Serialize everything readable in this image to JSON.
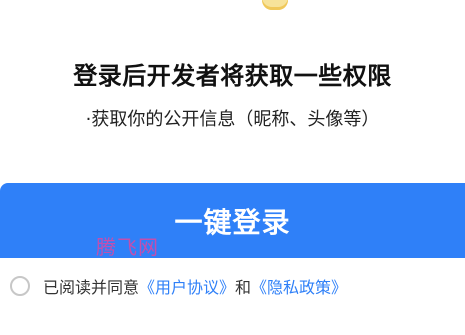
{
  "title": "登录后开发者将获取一些权限",
  "permission": "·获取你的公开信息（昵称、头像等）",
  "login_button": "一键登录",
  "watermark": "腾飞网",
  "agreement": {
    "prefix": "已阅读并同意",
    "user_agreement": "《用户协议》",
    "and": "和",
    "privacy_policy": "《隐私政策》"
  },
  "colors": {
    "primary": "#2f80f8",
    "watermark": "#d44aa6"
  }
}
